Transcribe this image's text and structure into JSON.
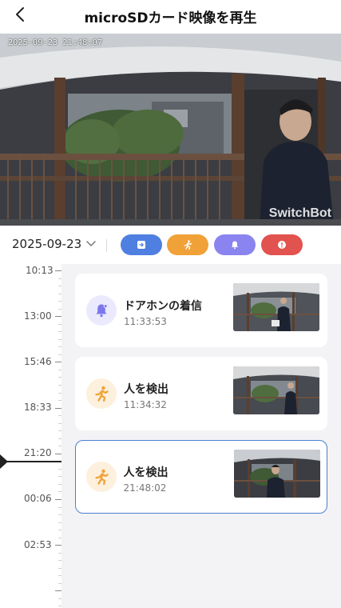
{
  "header": {
    "title": "microSDカード映像を再生",
    "back_icon": "chevron-left-icon"
  },
  "video": {
    "timestamp": "2025-09-23 21:48:07",
    "watermark": "SwitchBot"
  },
  "filter_bar": {
    "date": "2025-09-23",
    "chips": [
      {
        "name": "doorbell-filter",
        "icon": "doorbell-box-icon",
        "color": "#4f7fe0"
      },
      {
        "name": "person-filter",
        "icon": "running-person-icon",
        "color": "#f0a238"
      },
      {
        "name": "bell-filter",
        "icon": "bell-icon",
        "color": "#8a84f0"
      },
      {
        "name": "alert-filter",
        "icon": "exclamation-icon",
        "color": "#e2524e"
      }
    ]
  },
  "timeline": {
    "labels": [
      "10:13",
      "13:00",
      "15:46",
      "18:33",
      "21:20",
      "00:06",
      "02:53"
    ]
  },
  "events": [
    {
      "title": "ドアホンの着信",
      "time": "11:33:53",
      "icon": "bell-icon",
      "icon_color": "#7c77ee",
      "icon_bg": "#ebeafc",
      "active": false
    },
    {
      "title": "人を検出",
      "time": "11:34:32",
      "icon": "running-person-icon",
      "icon_color": "#f0a238",
      "icon_bg": "#fdf0dc",
      "active": false
    },
    {
      "title": "人を検出",
      "time": "21:48:02",
      "icon": "running-person-icon",
      "icon_color": "#f0a238",
      "icon_bg": "#fdf0dc",
      "active": true
    }
  ]
}
